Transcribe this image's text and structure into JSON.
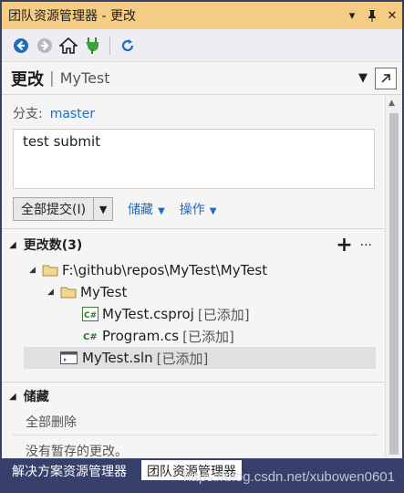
{
  "window": {
    "title": "团队资源管理器 - 更改",
    "controls": [
      "dropdown-arrow",
      "pin",
      "close"
    ]
  },
  "toolbar": {
    "icons": [
      "back-icon",
      "forward-icon",
      "home-icon",
      "connect-icon",
      "refresh-icon"
    ]
  },
  "header": {
    "page_title": "更改",
    "separator": "|",
    "repo": "MyTest"
  },
  "branch": {
    "label": "分支:",
    "name": "master"
  },
  "commit_message": "test submit",
  "actions": {
    "commit_label": "全部提交(I)",
    "stash_label": "储藏",
    "actions_label": "操作"
  },
  "changes": {
    "header": "更改数(3)",
    "tree": {
      "root_path": "F:\\github\\repos\\MyTest\\MyTest",
      "folder": "MyTest",
      "files": [
        {
          "name": "MyTest.csproj",
          "state": "[已添加]",
          "icon": "csharp-project-icon"
        },
        {
          "name": "Program.cs",
          "state": "[已添加]",
          "icon": "csharp-file-icon"
        }
      ],
      "solution": {
        "name": "MyTest.sln",
        "state": "[已添加]",
        "icon": "solution-icon"
      }
    }
  },
  "stashes": {
    "header": "储藏",
    "delete_all": "全部删除",
    "empty_text": "没有暂存的更改。"
  },
  "tabs": [
    {
      "label": "解决方案资源管理器",
      "active": false
    },
    {
      "label": "团队资源管理器",
      "active": true
    }
  ],
  "watermark": "https://blog.csdn.net/xubowen0601",
  "colors": {
    "title_bar": "#f5cc84",
    "link": "#1e6cc0",
    "tab_strip": "#36406a"
  }
}
